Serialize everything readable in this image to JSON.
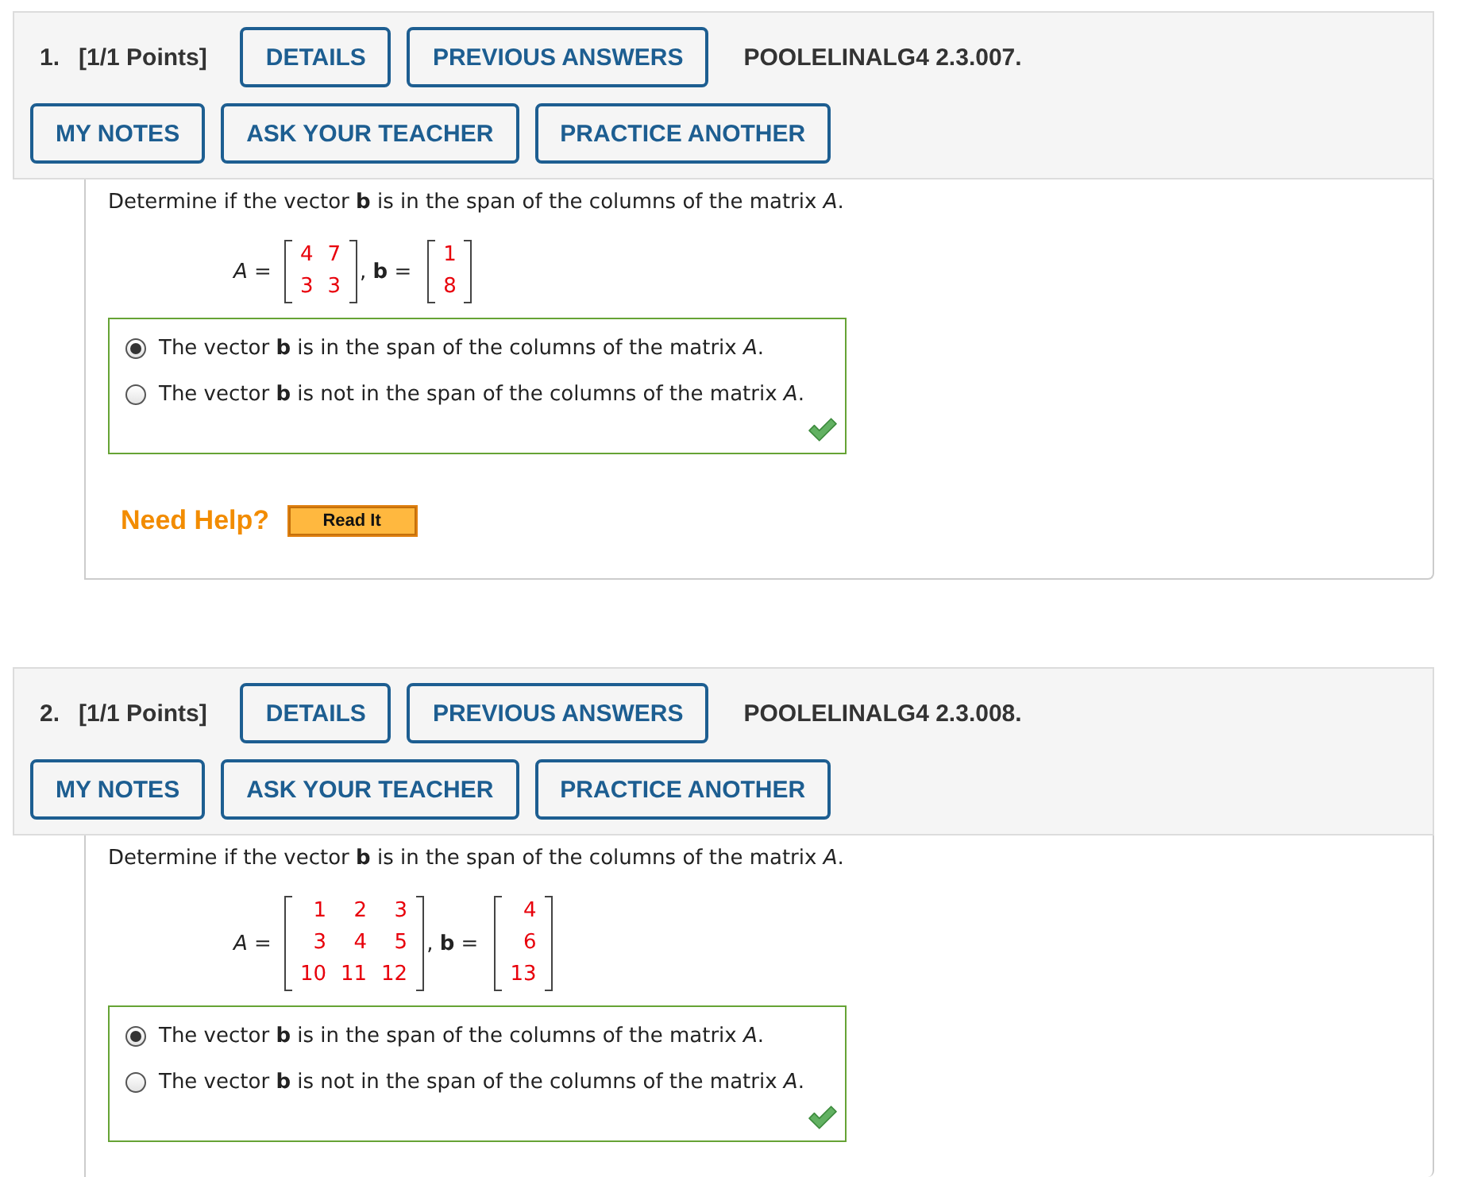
{
  "questions": [
    {
      "number": "1.",
      "points": "[1/1 Points]",
      "header_buttons": [
        "DETAILS",
        "PREVIOUS ANSWERS"
      ],
      "problem_code": "POOLELINALG4 2.3.007.",
      "action_buttons": [
        "MY NOTES",
        "ASK YOUR TEACHER",
        "PRACTICE ANOTHER"
      ],
      "prompt": "Determine if the vector **b** is in the span of the columns of the matrix *A*.",
      "equation": {
        "matrix_label": "*A* =",
        "matrix": [
          [
            "4",
            "7"
          ],
          [
            "3",
            "3"
          ]
        ],
        "vector_label": ", **b** =",
        "vector": [
          "1",
          "8"
        ]
      },
      "options": [
        {
          "text": "The vector **b** is in the span of the columns of the matrix *A*.",
          "selected": true
        },
        {
          "text": "The vector **b** is not in the span of the columns of the matrix *A*.",
          "selected": false
        }
      ],
      "correct": true,
      "help": {
        "label": "Need Help?",
        "button": "Read It"
      }
    },
    {
      "number": "2.",
      "points": "[1/1 Points]",
      "header_buttons": [
        "DETAILS",
        "PREVIOUS ANSWERS"
      ],
      "problem_code": "POOLELINALG4 2.3.008.",
      "action_buttons": [
        "MY NOTES",
        "ASK YOUR TEACHER",
        "PRACTICE ANOTHER"
      ],
      "prompt": "Determine if the vector **b** is in the span of the columns of the matrix *A*.",
      "equation": {
        "matrix_label": "*A* =",
        "matrix": [
          [
            "1",
            "2",
            "3"
          ],
          [
            "3",
            "4",
            "5"
          ],
          [
            "10",
            "11",
            "12"
          ]
        ],
        "vector_label": ", **b** =",
        "vector": [
          "4",
          "6",
          "13"
        ]
      },
      "options": [
        {
          "text": "The vector **b** is in the span of the columns of the matrix *A*.",
          "selected": true
        },
        {
          "text": "The vector **b** is not in the span of the columns of the matrix *A*.",
          "selected": false
        }
      ],
      "correct": true
    }
  ]
}
